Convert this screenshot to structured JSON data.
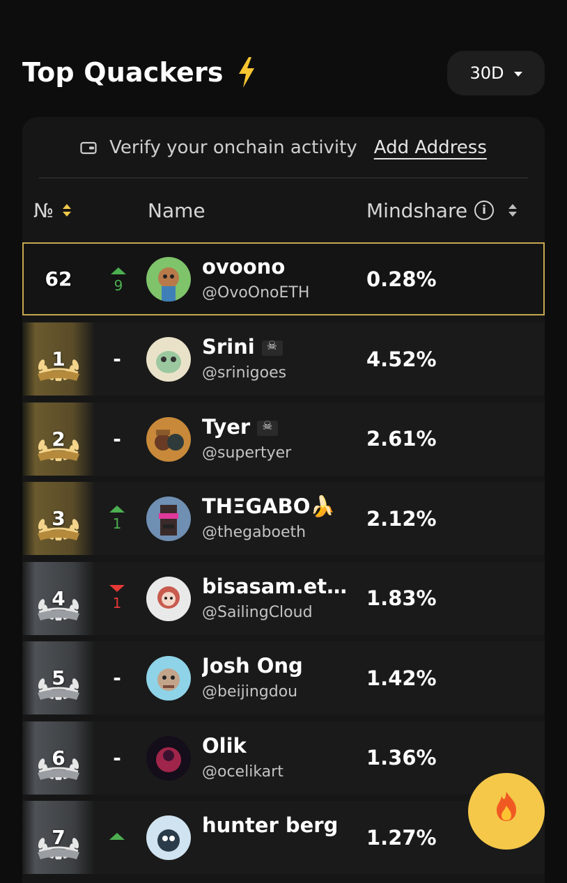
{
  "header": {
    "title": "Top Quackers",
    "period": "30D"
  },
  "verify": {
    "text": "Verify your onchain activity",
    "link": "Add Address"
  },
  "columns": {
    "rank": "№",
    "name": "Name",
    "mindshare": "Mindshare",
    "info": "i"
  },
  "me": {
    "rank": "62",
    "change_dir": "up",
    "change": "9",
    "name": "ovoono",
    "handle": "@OvoOnoETH",
    "share": "0.28%"
  },
  "rows": [
    {
      "rank": "1",
      "tier": "gold",
      "change_dir": "none",
      "change": "-",
      "name": "Srini",
      "badge": "pirate-flag",
      "handle": "@srinigoes",
      "share": "4.52%"
    },
    {
      "rank": "2",
      "tier": "gold",
      "change_dir": "none",
      "change": "-",
      "name": "Tyer",
      "badge": "pirate-flag",
      "handle": "@supertyer",
      "share": "2.61%"
    },
    {
      "rank": "3",
      "tier": "gold",
      "change_dir": "up",
      "change": "1",
      "name": "THΞGABO🍌",
      "badge": "",
      "handle": "@thegaboeth",
      "share": "2.12%"
    },
    {
      "rank": "4",
      "tier": "silver",
      "change_dir": "down",
      "change": "1",
      "name": "bisasam.et…",
      "badge": "",
      "handle": "@SailingCloud",
      "share": "1.83%"
    },
    {
      "rank": "5",
      "tier": "silver",
      "change_dir": "none",
      "change": "-",
      "name": "Josh Ong",
      "badge": "",
      "handle": "@beijingdou",
      "share": "1.42%"
    },
    {
      "rank": "6",
      "tier": "silver",
      "change_dir": "none",
      "change": "-",
      "name": "Olik",
      "badge": "",
      "handle": "@ocelikart",
      "share": "1.36%"
    },
    {
      "rank": "7",
      "tier": "silver",
      "change_dir": "up",
      "change": "",
      "name": "hunter berg",
      "badge": "",
      "handle": "",
      "share": "1.27%"
    }
  ],
  "colors": {
    "gold": "#c7a750",
    "up": "#4caf50",
    "down": "#e53935",
    "fire_button": "#f5c84a"
  },
  "icons": {
    "title": "lightning-icon",
    "fire": "fire-icon",
    "wallet": "wallet-icon"
  }
}
